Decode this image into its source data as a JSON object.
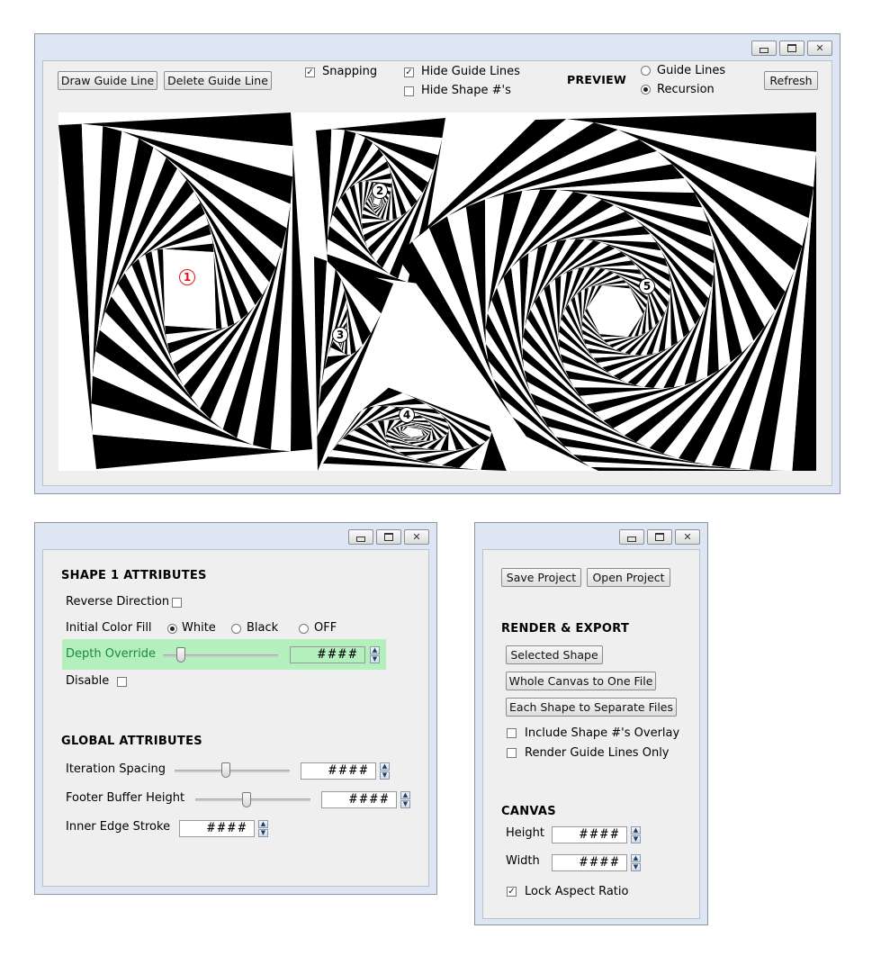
{
  "main_window": {
    "toolbar": {
      "draw_guide_line": "Draw Guide Line",
      "delete_guide_line": "Delete Guide Line",
      "snapping_label": "Snapping",
      "snapping_checked": true,
      "hide_guide_lines_label": "Hide Guide Lines",
      "hide_guide_lines_checked": true,
      "hide_shape_numbers_label": "Hide Shape #'s",
      "hide_shape_numbers_checked": false,
      "preview_label": "PREVIEW",
      "preview_options": [
        "Guide Lines",
        "Recursion"
      ],
      "preview_selected": "Recursion",
      "refresh": "Refresh"
    },
    "canvas": {
      "shape_markers": [
        "1",
        "2",
        "3",
        "4",
        "5"
      ],
      "selected_marker": "1",
      "selected_marker_color": "#e11111"
    }
  },
  "shape_panel": {
    "shape_title": "SHAPE 1 ATTRIBUTES",
    "reverse_direction": "Reverse Direction",
    "initial_color_fill": "Initial Color Fill",
    "fill_options": [
      "White",
      "Black",
      "OFF"
    ],
    "fill_selected": "White",
    "depth_override": "Depth Override",
    "depth_override_value": "####",
    "depth_highlight_color": "#b3f0bd",
    "disable": "Disable",
    "global_title": "GLOBAL ATTRIBUTES",
    "iteration_spacing": "Iteration Spacing",
    "iteration_spacing_value": "####",
    "footer_buffer_height": "Footer Buffer Height",
    "footer_buffer_height_value": "####",
    "inner_edge_stroke": "Inner Edge Stroke",
    "inner_edge_stroke_value": "####"
  },
  "project_panel": {
    "save_project": "Save Project",
    "open_project": "Open Project",
    "render_title": "RENDER & EXPORT",
    "selected_shape": "Selected Shape",
    "whole_canvas": "Whole Canvas to One File",
    "each_shape": "Each Shape to Separate Files",
    "include_overlay": "Include Shape #'s Overlay",
    "render_guides_only": "Render Guide Lines Only",
    "canvas_title": "CANVAS",
    "height_label": "Height",
    "height_value": "####",
    "width_label": "Width",
    "width_value": "####",
    "lock_aspect": "Lock Aspect Ratio",
    "lock_aspect_checked": true
  },
  "icons": [
    "minimize-icon",
    "maximize-icon",
    "close-icon",
    "spin-up-icon",
    "spin-down-icon",
    "checkmark-icon"
  ]
}
